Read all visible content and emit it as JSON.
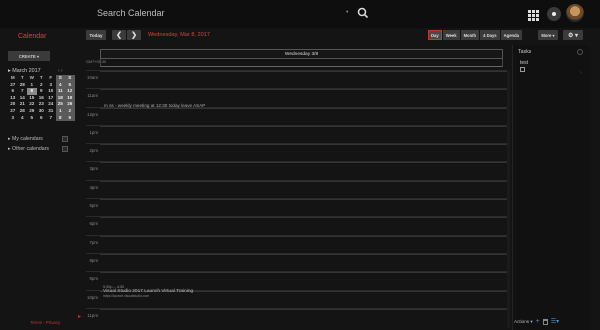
{
  "topbar": {
    "search_text": "Search Calendar",
    "search_dot": "•"
  },
  "header": {
    "app_title": "Calendar",
    "today_label": "Today",
    "prev_label": "❮",
    "next_label": "❯",
    "date_title": "Wednesday, Mar 8, 2017",
    "views": [
      "Day",
      "Week",
      "Month",
      "4 Days",
      "Agenda"
    ],
    "active_view": "Day",
    "more_label": "More ▾",
    "settings_label": "⚙ ▾"
  },
  "sidebar": {
    "create_label": "CREATE ▾",
    "mini_cal_title": "▸ March 2017",
    "mini_nav": "‹   ›",
    "day_headers": [
      "M",
      "T",
      "W",
      "T",
      "F",
      "S",
      "S"
    ],
    "weeks": [
      [
        "27",
        "28",
        "1",
        "2",
        "3",
        "4",
        "5"
      ],
      [
        "6",
        "7",
        "8",
        "9",
        "10",
        "11",
        "12"
      ],
      [
        "13",
        "14",
        "15",
        "16",
        "17",
        "18",
        "19"
      ],
      [
        "20",
        "21",
        "22",
        "23",
        "24",
        "25",
        "26"
      ],
      [
        "27",
        "28",
        "29",
        "30",
        "31",
        "1",
        "2"
      ],
      [
        "3",
        "4",
        "5",
        "6",
        "7",
        "8",
        "9"
      ]
    ],
    "selected_day": "8",
    "my_calendars": "▸ My calendars",
    "other_calendars": "▸ Other calendars",
    "terms": "Terms - Privacy",
    "side_arrow": "▸"
  },
  "grid": {
    "day_header": "Wednesday 3/8",
    "timezone": "GMT+05:30",
    "hours": [
      "10am",
      "11am",
      "12pm",
      "1pm",
      "2pm",
      "3pm",
      "4pm",
      "5pm",
      "6pm",
      "7pm",
      "8pm",
      "9pm",
      "10pm",
      "11pm"
    ],
    "event1": "m ss - weekly meeting at 12:30 today leave ASAP",
    "event2_time": "9:30p – 4:30",
    "event2_title": "Visual Studio 2017 Launch Virtual Training",
    "event2_url": "https://launch.visualstudio.com"
  },
  "tasks": {
    "title": "Tasks",
    "task_name": "test",
    "actions_label": "Actions ▾",
    "add_icon": "+",
    "list_icon": "☰▾",
    "arrow": "›"
  },
  "colors": {
    "accent": "#d04a37",
    "background": "#141414",
    "button": "#3b3b3b",
    "link_blue": "#4a8fd4"
  }
}
